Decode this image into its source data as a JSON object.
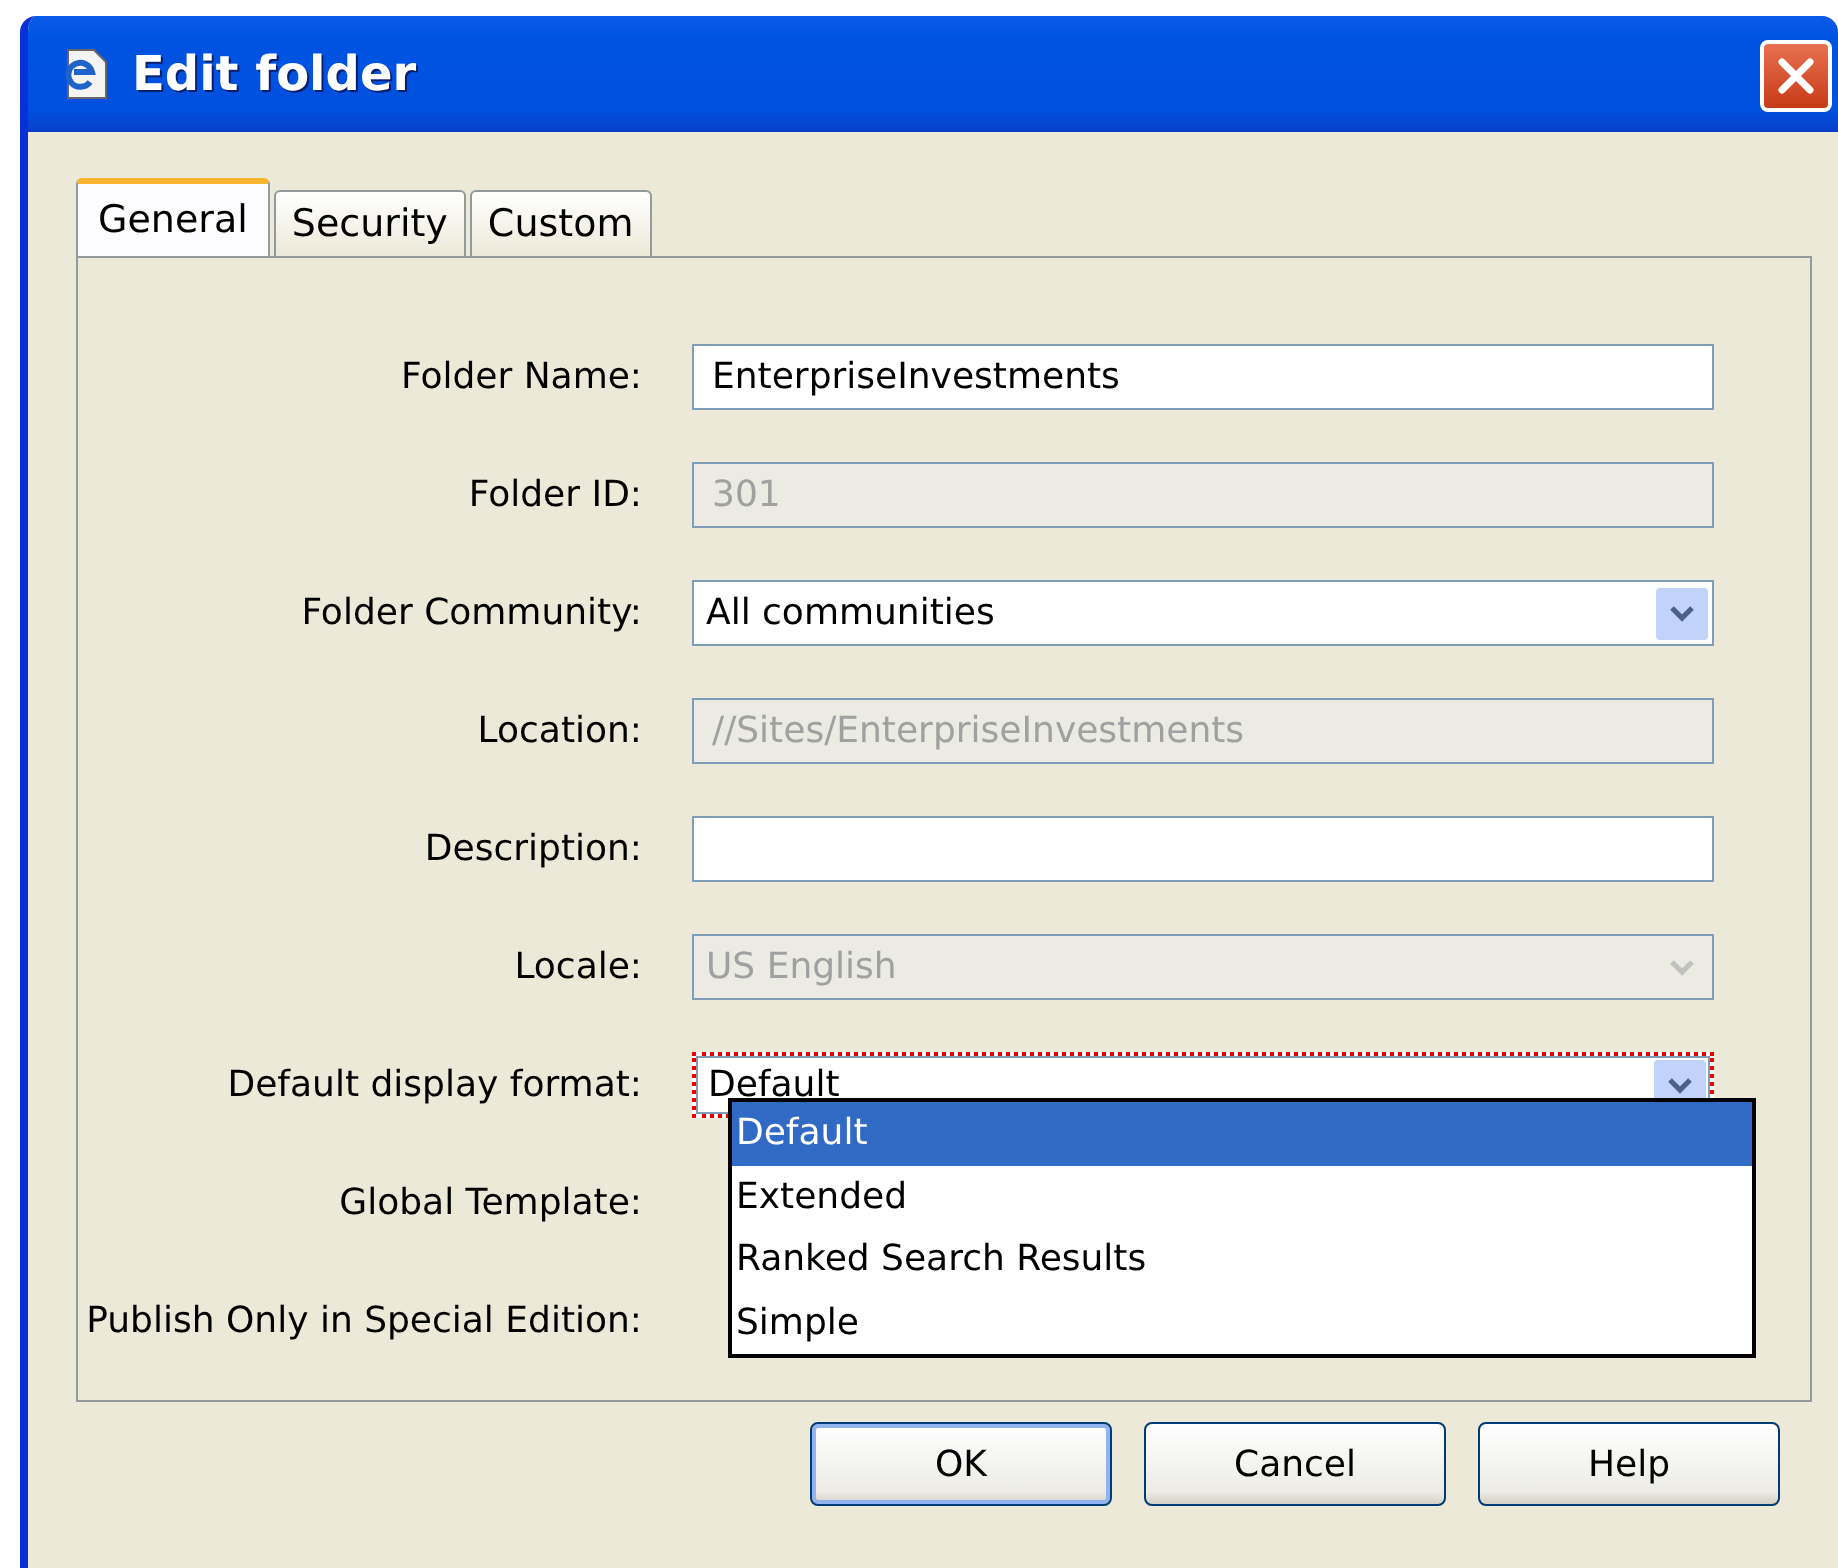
{
  "window": {
    "title": "Edit folder"
  },
  "tabs": [
    {
      "label": "General",
      "selected": true
    },
    {
      "label": "Security",
      "selected": false
    },
    {
      "label": "Custom",
      "selected": false
    }
  ],
  "fields": [
    {
      "label": "Folder Name:",
      "kind": "text",
      "value": "EnterpriseInvestments",
      "disabled": false,
      "focused": false
    },
    {
      "label": "Folder ID:",
      "kind": "text",
      "value": "301",
      "disabled": true,
      "focused": false
    },
    {
      "label": "Folder Community:",
      "kind": "select",
      "value": "All communities",
      "disabled": false,
      "focused": false
    },
    {
      "label": "Location:",
      "kind": "text",
      "value": "//Sites/EnterpriseInvestments",
      "disabled": true,
      "focused": false
    },
    {
      "label": "Description:",
      "kind": "text",
      "disabled": false,
      "focused": false
    },
    {
      "label": "Locale:",
      "kind": "select",
      "value": "US English",
      "disabled": true,
      "focused": false
    },
    {
      "label": "Default display format:",
      "kind": "select",
      "value": "Default",
      "disabled": false,
      "focused": true,
      "options": [
        {
          "label": "Default",
          "selected": true
        },
        {
          "label": "Extended",
          "selected": false
        },
        {
          "label": "Ranked Search Results",
          "selected": false
        },
        {
          "label": "Simple",
          "selected": false
        }
      ]
    },
    {
      "label": "Global Template:",
      "kind": "covered"
    },
    {
      "label": "Publish Only in Special Edition:",
      "kind": "covered"
    }
  ],
  "buttons": [
    {
      "label": "OK",
      "default": true
    },
    {
      "label": "Cancel",
      "default": false
    },
    {
      "label": "Help",
      "default": false
    }
  ]
}
